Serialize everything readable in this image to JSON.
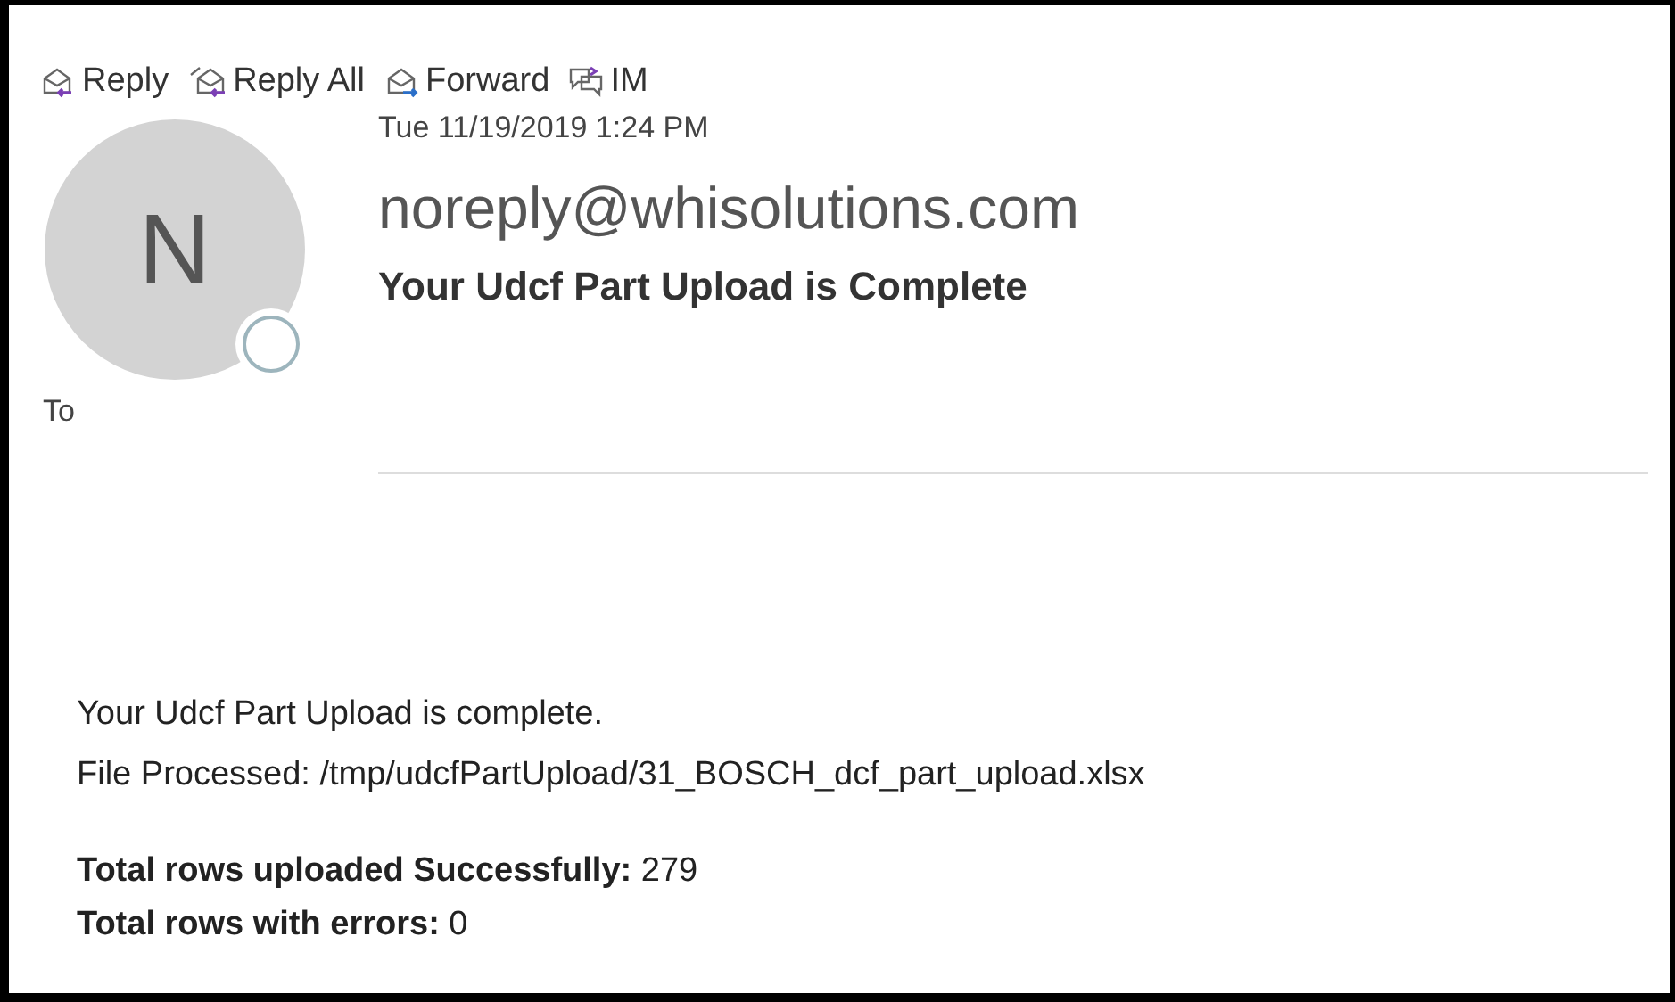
{
  "toolbar": [
    {
      "kind": "reply",
      "label": "Reply"
    },
    {
      "kind": "reply_all",
      "label": "Reply All"
    },
    {
      "kind": "forward",
      "label": "Forward"
    },
    {
      "kind": "im",
      "label": "IM"
    }
  ],
  "message": {
    "avatar_initial": "N",
    "date": "Tue 11/19/2019 1:24 PM",
    "sender": "noreply@whisolutions.com",
    "subject": "Your Udcf Part Upload is Complete",
    "to_label": "To"
  },
  "body": {
    "lines": [
      "Your Udcf Part Upload is complete.",
      "File Processed: /tmp/udcfPartUpload/31_BOSCH_dcf_part_upload.xlsx"
    ],
    "totals": [
      "**Total rows uploaded Successfully:** 279",
      "**Total rows with errors:** 0"
    ]
  }
}
